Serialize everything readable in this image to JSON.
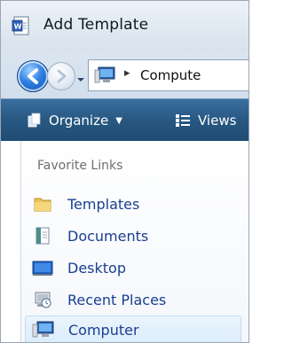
{
  "window": {
    "title": "Add Template"
  },
  "nav": {
    "address": {
      "path_text": "Compute",
      "chevron": "▸"
    }
  },
  "toolbar": {
    "organize_label": "Organize",
    "views_label": "Views"
  },
  "favorites": {
    "header": "Favorite Links",
    "items": [
      {
        "label": "Templates",
        "icon": "folder-icon"
      },
      {
        "label": "Documents",
        "icon": "documents-icon"
      },
      {
        "label": "Desktop",
        "icon": "desktop-icon"
      },
      {
        "label": "Recent Places",
        "icon": "recent-places-icon"
      },
      {
        "label": "Computer",
        "icon": "computer-icon",
        "selected": true
      }
    ]
  },
  "colors": {
    "link": "#1a3f8f",
    "toolbar": "#285882",
    "selection": "#dcedfb"
  }
}
